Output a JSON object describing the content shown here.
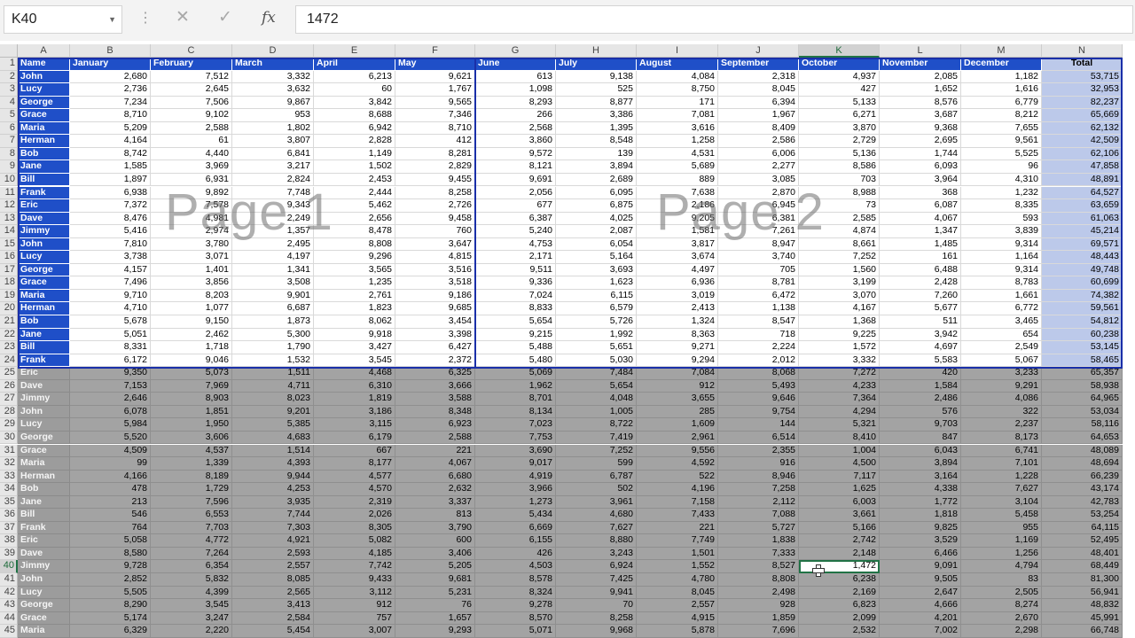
{
  "formula_bar": {
    "name_box": "K40",
    "cancel_icon": "✕",
    "enter_icon": "✓",
    "fx_label": "fx",
    "formula_value": "1472"
  },
  "columns": [
    "A",
    "B",
    "C",
    "D",
    "E",
    "F",
    "G",
    "H",
    "I",
    "J",
    "K",
    "L",
    "M",
    "N"
  ],
  "selected_column": "K",
  "selected_row": 40,
  "headers": [
    "Name",
    "January",
    "February",
    "March",
    "April",
    "May",
    "June",
    "July",
    "August",
    "September",
    "October",
    "November",
    "December",
    "Total"
  ],
  "rows": [
    [
      "John",
      "2,680",
      "7,512",
      "3,332",
      "6,213",
      "9,621",
      "613",
      "9,138",
      "4,084",
      "2,318",
      "4,937",
      "2,085",
      "1,182",
      "53,715"
    ],
    [
      "Lucy",
      "2,736",
      "2,645",
      "3,632",
      "60",
      "1,767",
      "1,098",
      "525",
      "8,750",
      "8,045",
      "427",
      "1,652",
      "1,616",
      "32,953"
    ],
    [
      "George",
      "7,234",
      "7,506",
      "9,867",
      "3,842",
      "9,565",
      "8,293",
      "8,877",
      "171",
      "6,394",
      "5,133",
      "8,576",
      "6,779",
      "82,237"
    ],
    [
      "Grace",
      "8,710",
      "9,102",
      "953",
      "8,688",
      "7,346",
      "266",
      "3,386",
      "7,081",
      "1,967",
      "6,271",
      "3,687",
      "8,212",
      "65,669"
    ],
    [
      "Maria",
      "5,209",
      "2,588",
      "1,802",
      "6,942",
      "8,710",
      "2,568",
      "1,395",
      "3,616",
      "8,409",
      "3,870",
      "9,368",
      "7,655",
      "62,132"
    ],
    [
      "Herman",
      "4,164",
      "61",
      "3,807",
      "2,828",
      "412",
      "3,860",
      "8,548",
      "1,258",
      "2,586",
      "2,729",
      "2,695",
      "9,561",
      "42,509"
    ],
    [
      "Bob",
      "8,742",
      "4,440",
      "6,841",
      "1,149",
      "8,281",
      "9,572",
      "139",
      "4,531",
      "6,006",
      "5,136",
      "1,744",
      "5,525",
      "62,106"
    ],
    [
      "Jane",
      "1,585",
      "3,969",
      "3,217",
      "1,502",
      "2,829",
      "8,121",
      "3,894",
      "5,689",
      "2,277",
      "8,586",
      "6,093",
      "96",
      "47,858"
    ],
    [
      "Bill",
      "1,897",
      "6,931",
      "2,824",
      "2,453",
      "9,455",
      "9,691",
      "2,689",
      "889",
      "3,085",
      "703",
      "3,964",
      "4,310",
      "48,891"
    ],
    [
      "Frank",
      "6,938",
      "9,892",
      "7,748",
      "2,444",
      "8,258",
      "2,056",
      "6,095",
      "7,638",
      "2,870",
      "8,988",
      "368",
      "1,232",
      "64,527"
    ],
    [
      "Eric",
      "7,372",
      "7,578",
      "9,343",
      "5,462",
      "2,726",
      "677",
      "6,875",
      "2,186",
      "6,945",
      "73",
      "6,087",
      "8,335",
      "63,659"
    ],
    [
      "Dave",
      "8,476",
      "4,981",
      "2,249",
      "2,656",
      "9,458",
      "6,387",
      "4,025",
      "9,205",
      "6,381",
      "2,585",
      "4,067",
      "593",
      "61,063"
    ],
    [
      "Jimmy",
      "5,416",
      "2,974",
      "1,357",
      "8,478",
      "760",
      "5,240",
      "2,087",
      "1,581",
      "7,261",
      "4,874",
      "1,347",
      "3,839",
      "45,214"
    ],
    [
      "John",
      "7,810",
      "3,780",
      "2,495",
      "8,808",
      "3,647",
      "4,753",
      "6,054",
      "3,817",
      "8,947",
      "8,661",
      "1,485",
      "9,314",
      "69,571"
    ],
    [
      "Lucy",
      "3,738",
      "3,071",
      "4,197",
      "9,296",
      "4,815",
      "2,171",
      "5,164",
      "3,674",
      "3,740",
      "7,252",
      "161",
      "1,164",
      "48,443"
    ],
    [
      "George",
      "4,157",
      "1,401",
      "1,341",
      "3,565",
      "3,516",
      "9,511",
      "3,693",
      "4,497",
      "705",
      "1,560",
      "6,488",
      "9,314",
      "49,748"
    ],
    [
      "Grace",
      "7,496",
      "3,856",
      "3,508",
      "1,235",
      "3,518",
      "9,336",
      "1,623",
      "6,936",
      "8,781",
      "3,199",
      "2,428",
      "8,783",
      "60,699"
    ],
    [
      "Maria",
      "9,710",
      "8,203",
      "9,901",
      "2,761",
      "9,186",
      "7,024",
      "6,115",
      "3,019",
      "6,472",
      "3,070",
      "7,260",
      "1,661",
      "74,382"
    ],
    [
      "Herman",
      "4,710",
      "1,077",
      "6,687",
      "1,823",
      "9,685",
      "8,833",
      "6,579",
      "2,413",
      "1,138",
      "4,167",
      "5,677",
      "6,772",
      "59,561"
    ],
    [
      "Bob",
      "5,678",
      "9,150",
      "1,873",
      "8,062",
      "3,454",
      "5,654",
      "5,726",
      "1,324",
      "8,547",
      "1,368",
      "511",
      "3,465",
      "54,812"
    ],
    [
      "Jane",
      "5,051",
      "2,462",
      "5,300",
      "9,918",
      "3,398",
      "9,215",
      "1,992",
      "8,363",
      "718",
      "9,225",
      "3,942",
      "654",
      "60,238"
    ],
    [
      "Bill",
      "8,331",
      "1,718",
      "1,790",
      "3,427",
      "6,427",
      "5,488",
      "5,651",
      "9,271",
      "2,224",
      "1,572",
      "4,697",
      "2,549",
      "53,145"
    ],
    [
      "Frank",
      "6,172",
      "9,046",
      "1,532",
      "3,545",
      "2,372",
      "5,480",
      "5,030",
      "9,294",
      "2,012",
      "3,332",
      "5,583",
      "5,067",
      "58,465"
    ],
    [
      "Eric",
      "9,350",
      "5,073",
      "1,511",
      "4,468",
      "6,325",
      "5,069",
      "7,484",
      "7,084",
      "8,068",
      "7,272",
      "420",
      "3,233",
      "65,357"
    ],
    [
      "Dave",
      "7,153",
      "7,969",
      "4,711",
      "6,310",
      "3,666",
      "1,962",
      "5,654",
      "912",
      "5,493",
      "4,233",
      "1,584",
      "9,291",
      "58,938"
    ],
    [
      "Jimmy",
      "2,646",
      "8,903",
      "8,023",
      "1,819",
      "3,588",
      "8,701",
      "4,048",
      "3,655",
      "9,646",
      "7,364",
      "2,486",
      "4,086",
      "64,965"
    ],
    [
      "John",
      "6,078",
      "1,851",
      "9,201",
      "3,186",
      "8,348",
      "8,134",
      "1,005",
      "285",
      "9,754",
      "4,294",
      "576",
      "322",
      "53,034"
    ],
    [
      "Lucy",
      "5,984",
      "1,950",
      "5,385",
      "3,115",
      "6,923",
      "7,023",
      "8,722",
      "1,609",
      "144",
      "5,321",
      "9,703",
      "2,237",
      "58,116"
    ],
    [
      "George",
      "5,520",
      "3,606",
      "4,683",
      "6,179",
      "2,588",
      "7,753",
      "7,419",
      "2,961",
      "6,514",
      "8,410",
      "847",
      "8,173",
      "64,653"
    ],
    [
      "Grace",
      "4,509",
      "4,537",
      "1,514",
      "667",
      "221",
      "3,690",
      "7,252",
      "9,556",
      "2,355",
      "1,004",
      "6,043",
      "6,741",
      "48,089"
    ],
    [
      "Maria",
      "99",
      "1,339",
      "4,393",
      "8,177",
      "4,067",
      "9,017",
      "599",
      "4,592",
      "916",
      "4,500",
      "3,894",
      "7,101",
      "48,694"
    ],
    [
      "Herman",
      "4,166",
      "8,189",
      "9,944",
      "4,577",
      "6,680",
      "4,919",
      "6,787",
      "522",
      "8,946",
      "7,117",
      "3,164",
      "1,228",
      "66,239"
    ],
    [
      "Bob",
      "478",
      "1,729",
      "4,253",
      "4,570",
      "2,632",
      "3,966",
      "502",
      "4,196",
      "7,258",
      "1,625",
      "4,338",
      "7,627",
      "43,174"
    ],
    [
      "Jane",
      "213",
      "7,596",
      "3,935",
      "2,319",
      "3,337",
      "1,273",
      "3,961",
      "7,158",
      "2,112",
      "6,003",
      "1,772",
      "3,104",
      "42,783"
    ],
    [
      "Bill",
      "546",
      "6,553",
      "7,744",
      "2,026",
      "813",
      "5,434",
      "4,680",
      "7,433",
      "7,088",
      "3,661",
      "1,818",
      "5,458",
      "53,254"
    ],
    [
      "Frank",
      "764",
      "7,703",
      "7,303",
      "8,305",
      "3,790",
      "6,669",
      "7,627",
      "221",
      "5,727",
      "5,166",
      "9,825",
      "955",
      "64,115"
    ],
    [
      "Eric",
      "5,058",
      "4,772",
      "4,921",
      "5,082",
      "600",
      "6,155",
      "8,880",
      "7,749",
      "1,838",
      "2,742",
      "3,529",
      "1,169",
      "52,495"
    ],
    [
      "Dave",
      "8,580",
      "7,264",
      "2,593",
      "4,185",
      "3,406",
      "426",
      "3,243",
      "1,501",
      "7,333",
      "2,148",
      "6,466",
      "1,256",
      "48,401"
    ],
    [
      "Jimmy",
      "9,728",
      "6,354",
      "2,557",
      "7,742",
      "5,205",
      "4,503",
      "6,924",
      "1,552",
      "8,527",
      "1,472",
      "9,091",
      "4,794",
      "68,449"
    ],
    [
      "John",
      "2,852",
      "5,832",
      "8,085",
      "9,433",
      "9,681",
      "8,578",
      "7,425",
      "4,780",
      "8,808",
      "6,238",
      "9,505",
      "83",
      "81,300"
    ],
    [
      "Lucy",
      "5,505",
      "4,399",
      "2,565",
      "3,112",
      "5,231",
      "8,324",
      "9,941",
      "8,045",
      "2,498",
      "2,169",
      "2,647",
      "2,505",
      "56,941"
    ],
    [
      "George",
      "8,290",
      "3,545",
      "3,413",
      "912",
      "76",
      "9,278",
      "70",
      "2,557",
      "928",
      "6,823",
      "4,666",
      "8,274",
      "48,832"
    ],
    [
      "Grace",
      "5,174",
      "3,247",
      "2,584",
      "757",
      "1,657",
      "8,570",
      "8,258",
      "4,915",
      "1,859",
      "2,099",
      "4,201",
      "2,670",
      "45,991"
    ],
    [
      "Maria",
      "6,329",
      "2,220",
      "5,454",
      "3,007",
      "9,293",
      "5,071",
      "9,968",
      "5,878",
      "7,696",
      "2,532",
      "7,002",
      "2,298",
      "66,748"
    ]
  ],
  "watermarks": [
    "Page 1",
    "Page 2"
  ]
}
